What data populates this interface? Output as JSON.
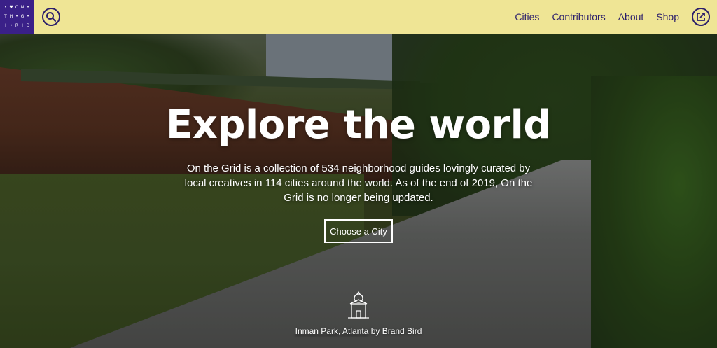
{
  "logo": {
    "letters": [
      "•",
      "♥",
      "O",
      "N",
      "•",
      "T",
      "H",
      "•",
      "G",
      "•",
      "I",
      "•",
      "R",
      "I",
      "D"
    ]
  },
  "nav": {
    "cities": "Cities",
    "contributors": "Contributors",
    "about": "About",
    "shop": "Shop"
  },
  "hero": {
    "title": "Explore the world",
    "description": "On the Grid is a collection of 534 neighborhood guides lovingly curated by local creatives in 114 cities around the world. As of the end of 2019, On the Grid is no longer being updated.",
    "cta_label": "Choose a City"
  },
  "credit": {
    "place": "Inman Park, Atlanta",
    "by": "by Brand Bird"
  },
  "colors": {
    "header_bg": "#efe595",
    "brand_purple": "#3a2088"
  }
}
